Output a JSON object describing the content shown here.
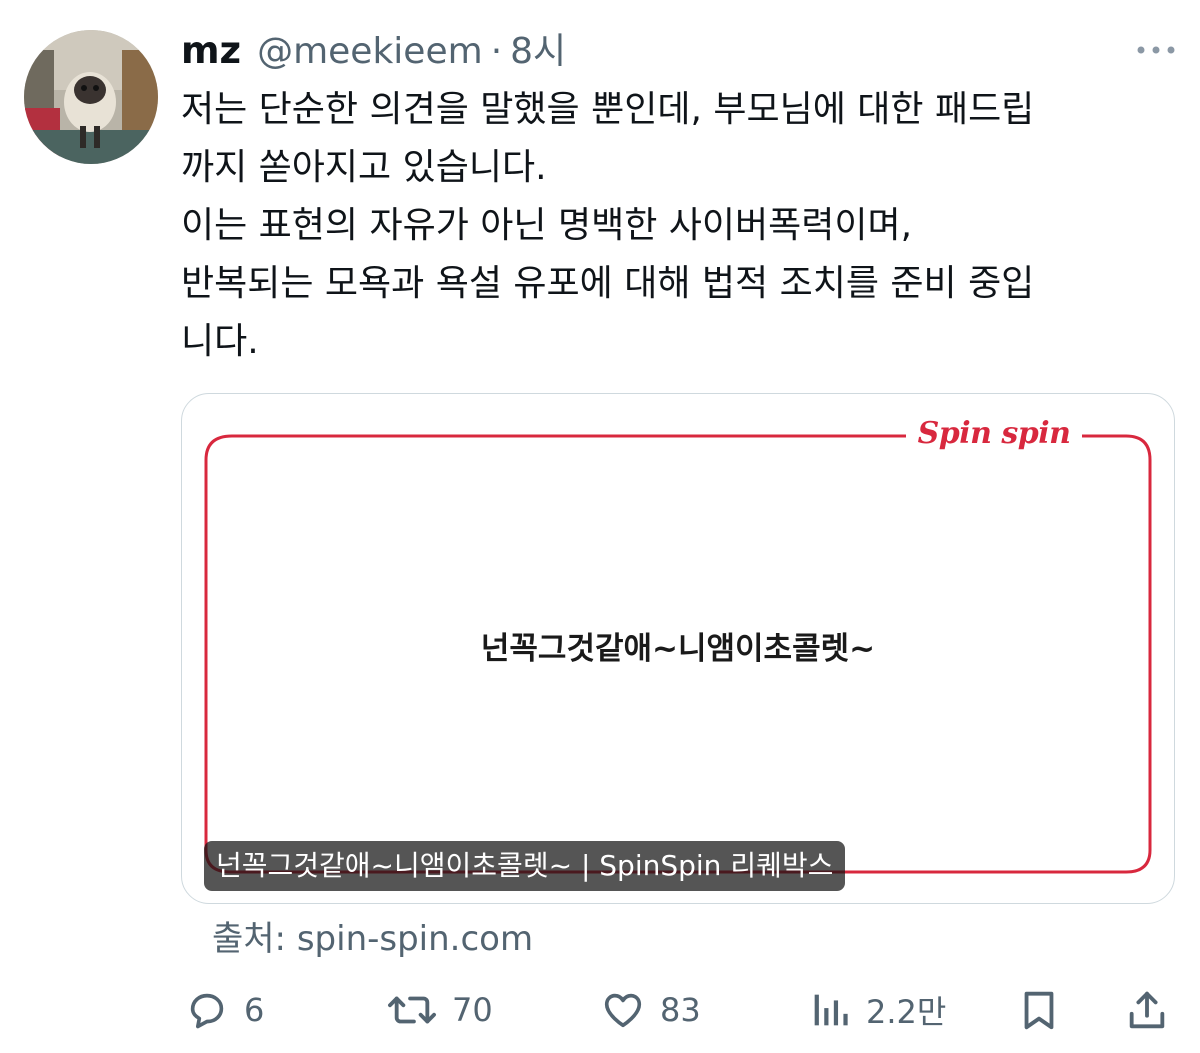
{
  "tweet": {
    "display_name": "mz",
    "handle": "@meekieem",
    "separator": "·",
    "time": "8시",
    "text_lines": [
      "저는 단순한 의견을 말했을 뿐인데, 부모님에 대한 패드립",
      "까지 쏟아지고 있습니다.",
      "이는 표현의 자유가 아닌 명백한 사이버폭력이며,",
      "반복되는 모욕과 욕설 유포에 대해 법적 조치를 준비 중입",
      "니다."
    ]
  },
  "card": {
    "logo_text": "Spin spin",
    "question": "넌꼭그것같애~니앰이초콜렛~",
    "caption": "넌꼭그것같애~니앰이초콜렛~ | SpinSpin 리퀘박스",
    "frame_color": "#d8283e"
  },
  "source": {
    "text": "출처: spin-spin.com"
  },
  "actions": {
    "reply_count": "6",
    "retweet_count": "70",
    "like_count": "83",
    "views_count": "2.2만"
  },
  "icons": {
    "more": "more-horizontal-icon",
    "reply": "reply-bubble-icon",
    "retweet": "retweet-icon",
    "like": "heart-icon",
    "views": "views-chart-icon",
    "bookmark": "bookmark-icon",
    "share": "share-icon"
  },
  "colors": {
    "text_primary": "#0f1419",
    "text_secondary": "#536471",
    "border": "#cfd9de",
    "accent_red": "#d8283e"
  }
}
